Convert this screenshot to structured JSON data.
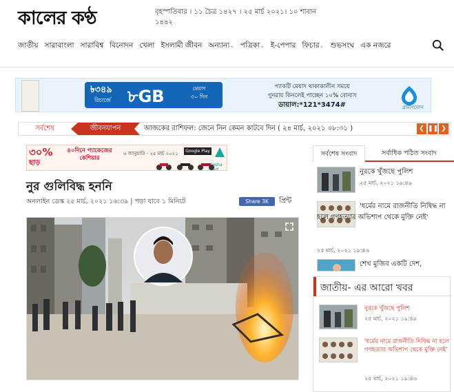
{
  "header": {
    "logo": "কালের কণ্ঠ",
    "dateline": "বৃহস্পতিবার । ১১ চৈত্র ১৪২৭ । ২৫ মার্চ ২০২১। ১০ শাবান ১৪৪২"
  },
  "nav": {
    "items": [
      {
        "label": "জাতীয়",
        "caret": ""
      },
      {
        "label": "সারাবাংলা",
        "caret": ""
      },
      {
        "label": "সারাবিশ্ব",
        "caret": ""
      },
      {
        "label": "বিনোদন",
        "caret": ""
      },
      {
        "label": "খেলা",
        "caret": ""
      },
      {
        "label": "ইসলামী জীবন",
        "caret": ""
      },
      {
        "label": "অন্যান্য",
        "caret": "⌄"
      },
      {
        "label": "পত্রিকা",
        "caret": "⌄"
      },
      {
        "label": "ই-পেপার",
        "caret": ""
      },
      {
        "label": "ফিচার",
        "caret": "⌄"
      },
      {
        "label": "শুভসংঘ",
        "caret": ""
      },
      {
        "label": "এক নজরে",
        "caret": ""
      }
    ]
  },
  "banner_ad": {
    "price": "৳৩৪৯",
    "price_sub": "রিচার্জে",
    "data": "৮GB",
    "validity_line1": "মেয়াদ",
    "validity_line2": "৩০ দিন",
    "offer_line1": "প্যাকটি মেয়াদ থাকাকালীন সময়ে",
    "offer_line2": "পুনরায় কিনলেই পাচ্ছেন ১০% বোনাস",
    "dial": "ডায়াল:*121*3474#",
    "brand": "গ্রামীণফোন"
  },
  "ticker": {
    "latest_label": "সর্বশেষ",
    "tag": "জীবনযাপন",
    "news": "আজকের রাশিফল: জেনে নিন কেমন কাটবে দিন ( ২৪ মার্চ, ২০২১ ০৮:৩১ )",
    "prev": "❮",
    "pause": "❚❚",
    "next": "❯"
  },
  "small_ad": {
    "percent": "৩০%",
    "percent_sub": "ছাড়",
    "emi": "৪০দিনে প্যাকেজের কেশিয়ার",
    "note": "৬ জানুয়ারি - ২৫ মার্চ ২০২১",
    "store": "Google Play",
    "brand": "alesha mart"
  },
  "article": {
    "headline": "নুর গুলিবিদ্ধ হননি",
    "byline": "অনলাইন ডেস্ক  ২৫ মার্চ, ২০২১ ১৬:৩৯ | পড়া যাবে ১ মিনিটে",
    "share_label": "Share 3K",
    "print_label": "প্রিন্ট"
  },
  "sidebar": {
    "tabs": [
      "সর্বশেষ সংবাদ",
      "সর্বাধিক পঠিত সংবাদ"
    ],
    "items": [
      {
        "title": "নুরকে খুঁজছে পুলিশ",
        "time": "২৫ মার্চ, ২০২১ ১৯:৪৯"
      },
      {
        "title": "'ধর্মের নামে রাজনীতি নিষিদ্ধ না হলে গণহত্যার অভিশাপ থেকে মুক্তি নেই'",
        "time": "২৫ মার্চ, ২০২১ ১৯:৪৬"
      },
      {
        "title": "শেখ মুজিব একটি দেশ,",
        "time": ""
      }
    ],
    "more_heading": "জাতীয়- এর আরো খবর",
    "more_items": [
      {
        "title": "নুরকে খুঁজছে পুলিশ",
        "time": "২৫ মার্চ, ২০২১ ১৯:৪৯"
      },
      {
        "title": "'ধর্মের নামে রাজনীতি নিষিদ্ধ না হলে গণহত্যার অভিশাপ থেকে মুক্তি নেই'",
        "time": "২৫ মার্চ, ২০২১ ১৯:৪৬"
      }
    ]
  },
  "colors": {
    "accent": "#c8341f",
    "ticker_ctrl": "#e0601c",
    "facebook": "#4267b2",
    "gp_blue": "#1466b8"
  }
}
